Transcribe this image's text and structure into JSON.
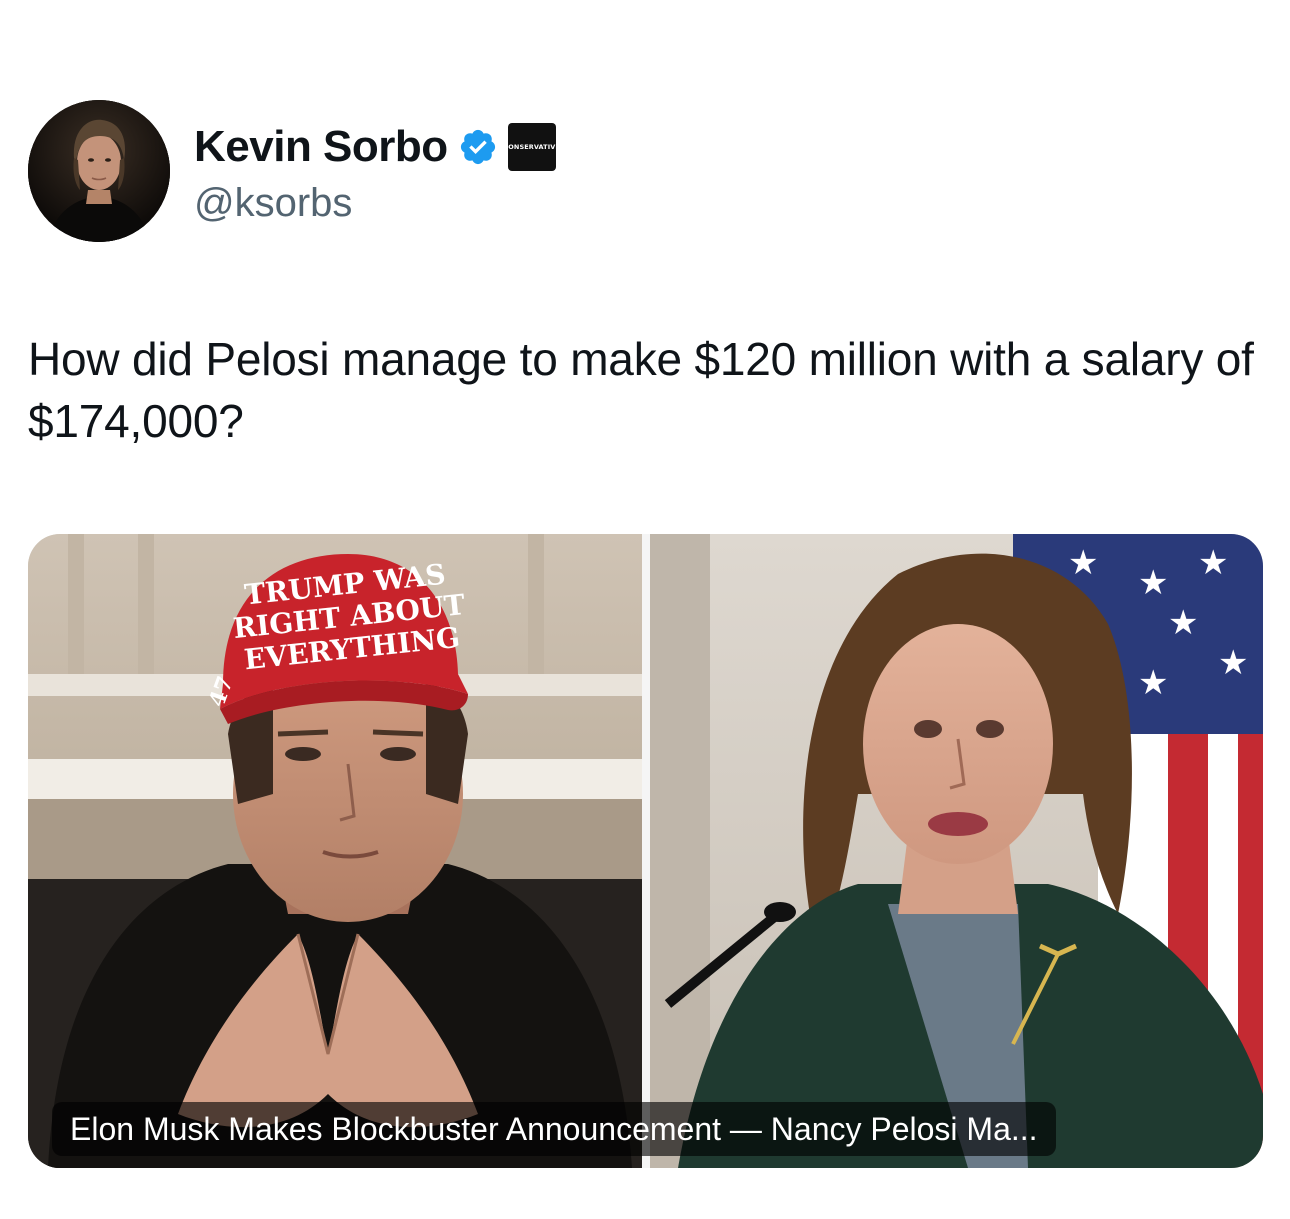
{
  "author": {
    "display_name": "Kevin Sorbo",
    "handle": "@ksorbs",
    "verified": true,
    "verified_color": "#1d9bf0",
    "affiliation_badge_text": "CONSERVATIVE",
    "avatar_icon": "avatar-photo"
  },
  "tweet": {
    "text": "How did Pelosi manage to make $120 million with a salary of $174,000?"
  },
  "card": {
    "title": "Elon Musk Makes Blockbuster Announcement — Nancy Pelosi Ma...",
    "left_image": {
      "hat_text_lines": [
        "TRUMP WAS",
        "RIGHT ABOUT",
        "EVERYTHING"
      ],
      "hat_side_text": "47"
    }
  },
  "colors": {
    "text_primary": "#0f1419",
    "text_secondary": "#536471",
    "hat_red": "#c8232b"
  }
}
